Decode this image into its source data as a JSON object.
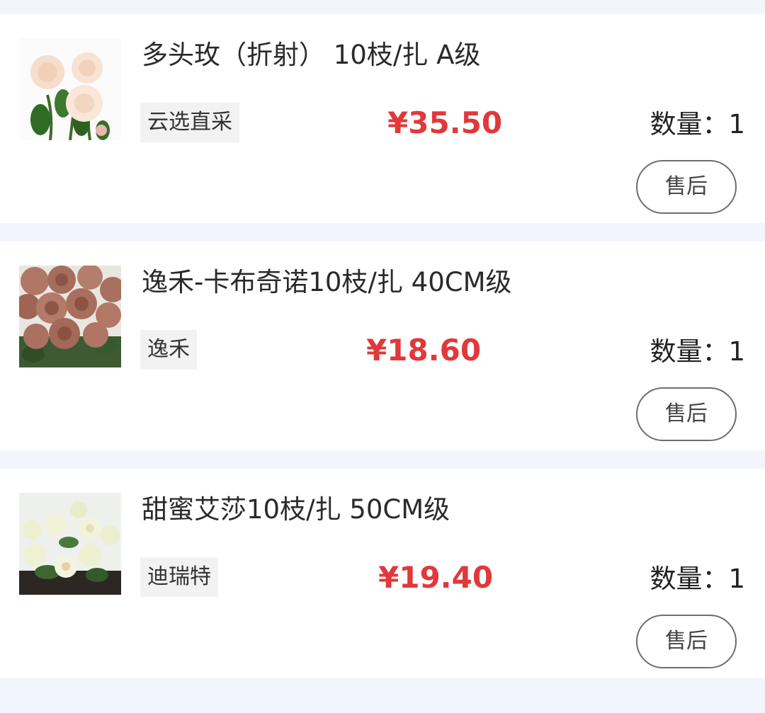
{
  "orders": [
    {
      "title": "多头玫（折射） 10枝/扎 A级",
      "supplier": "云选直采",
      "price": "¥35.50",
      "quantity_label": "数量：",
      "quantity": "1",
      "after_sale_label": "售后",
      "image_icon": "peach-spray-rose-photo"
    },
    {
      "title": "逸禾-卡布奇诺10枝/扎 40CM级",
      "supplier": "逸禾",
      "price": "¥18.60",
      "quantity_label": "数量：",
      "quantity": "1",
      "after_sale_label": "售后",
      "image_icon": "cappuccino-rose-photo"
    },
    {
      "title": "甜蜜艾莎10枝/扎 50CM级",
      "supplier": "迪瑞特",
      "price": "¥19.40",
      "quantity_label": "数量：",
      "quantity": "1",
      "after_sale_label": "售后",
      "image_icon": "white-rose-photo"
    }
  ],
  "colors": {
    "page_background": "#f2f5fc",
    "card_background": "#ffffff",
    "price": "#e0393b",
    "tag_background": "#f2f2f2",
    "button_border": "#6e6e6e"
  }
}
